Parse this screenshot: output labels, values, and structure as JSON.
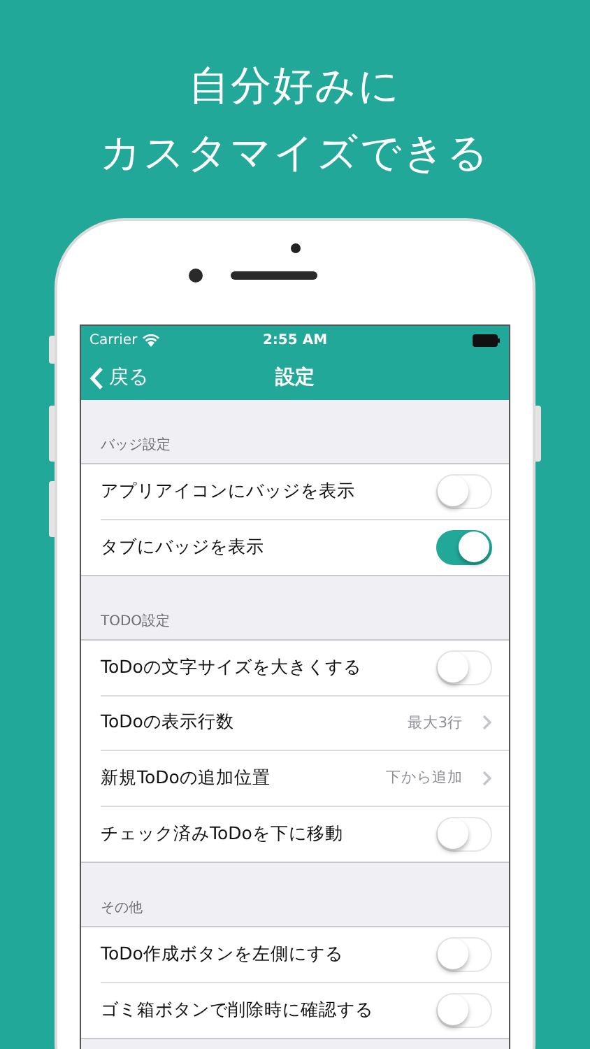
{
  "headline": [
    "自分好みに",
    "カスタマイズできる"
  ],
  "status_bar": {
    "carrier": "Carrier",
    "time": "2:55 AM"
  },
  "nav_bar": {
    "back": "戻る",
    "title": "設定"
  },
  "sections": [
    {
      "header": "バッジ設定",
      "rows": [
        {
          "kind": "toggle",
          "label": "アプリアイコンにバッジを表示",
          "on": false
        },
        {
          "kind": "toggle",
          "label": "タブにバッジを表示",
          "on": true
        }
      ]
    },
    {
      "header": "TODO設定",
      "rows": [
        {
          "kind": "toggle",
          "label": "ToDoの文字サイズを大きくする",
          "on": false
        },
        {
          "kind": "disclosure",
          "label": "ToDoの表示行数",
          "value": "最大3行"
        },
        {
          "kind": "disclosure",
          "label": "新規ToDoの追加位置",
          "value": "下から追加"
        },
        {
          "kind": "toggle",
          "label": "チェック済みToDoを下に移動",
          "on": false
        }
      ]
    },
    {
      "header": "その他",
      "rows": [
        {
          "kind": "toggle",
          "label": "ToDo作成ボタンを左側にする",
          "on": false
        },
        {
          "kind": "toggle",
          "label": "ゴミ箱ボタンで削除時に確認する",
          "on": false
        }
      ]
    }
  ]
}
